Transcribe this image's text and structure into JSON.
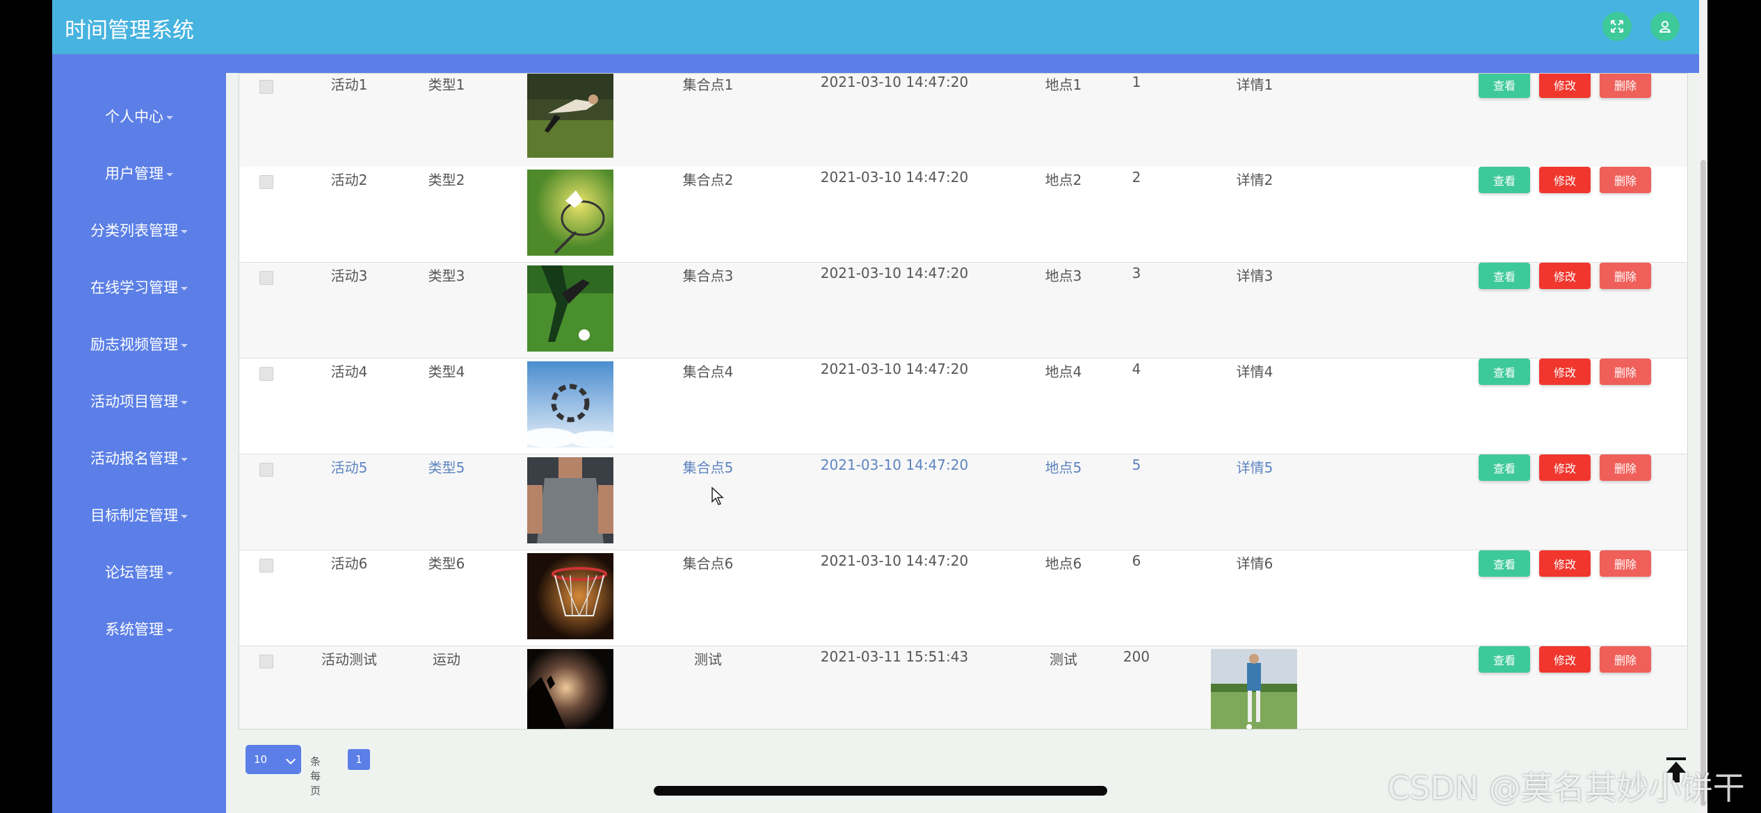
{
  "header": {
    "title": "时间管理系统"
  },
  "sidebar": {
    "items": [
      {
        "label": "个人中心"
      },
      {
        "label": "用户管理"
      },
      {
        "label": "分类列表管理"
      },
      {
        "label": "在线学习管理"
      },
      {
        "label": "励志视频管理"
      },
      {
        "label": "活动项目管理"
      },
      {
        "label": "活动报名管理"
      },
      {
        "label": "目标制定管理"
      },
      {
        "label": "论坛管理"
      },
      {
        "label": "系统管理"
      }
    ]
  },
  "table": {
    "rows": [
      {
        "name": "活动1",
        "type": "类型1",
        "meeting": "集合点1",
        "time": "2021-03-10 14:47:20",
        "place": "地点1",
        "num": "1",
        "detail": "详情1",
        "image": "sports-photo"
      },
      {
        "name": "活动2",
        "type": "类型2",
        "meeting": "集合点2",
        "time": "2021-03-10 14:47:20",
        "place": "地点2",
        "num": "2",
        "detail": "详情2",
        "image": "badminton-photo"
      },
      {
        "name": "活动3",
        "type": "类型3",
        "meeting": "集合点3",
        "time": "2021-03-10 14:47:20",
        "place": "地点3",
        "num": "3",
        "detail": "详情3",
        "image": "soccer-photo"
      },
      {
        "name": "活动4",
        "type": "类型4",
        "meeting": "集合点4",
        "time": "2021-03-10 14:47:20",
        "place": "地点4",
        "num": "4",
        "detail": "详情4",
        "image": "skydiving-photo"
      },
      {
        "name": "活动5",
        "type": "类型5",
        "meeting": "集合点5",
        "time": "2021-03-10 14:47:20",
        "place": "地点5",
        "num": "5",
        "detail": "详情5",
        "image": "fitness-photo"
      },
      {
        "name": "活动6",
        "type": "类型6",
        "meeting": "集合点6",
        "time": "2021-03-10 14:47:20",
        "place": "地点6",
        "num": "6",
        "detail": "详情6",
        "image": "basketball-hoop-photo"
      },
      {
        "name": "活动测试",
        "type": "运动",
        "meeting": "测试",
        "time": "2021-03-11 15:51:43",
        "place": "测试",
        "num": "200",
        "detail": "",
        "image": "climbing-photo",
        "detail_image": "golf-photo"
      }
    ],
    "actions": {
      "view": "查看",
      "edit": "修改",
      "delete": "删除"
    }
  },
  "pager": {
    "page_size": "10",
    "per_page_label": "条每页",
    "current_page": "1"
  },
  "watermark": "CSDN @莫名其妙小饼干",
  "colors": {
    "header": "#46b3e0",
    "sidebar": "#5b7fe6",
    "view_btn": "#3ec99a",
    "edit_btn": "#f0362d",
    "delete_btn": "#f0605a"
  }
}
